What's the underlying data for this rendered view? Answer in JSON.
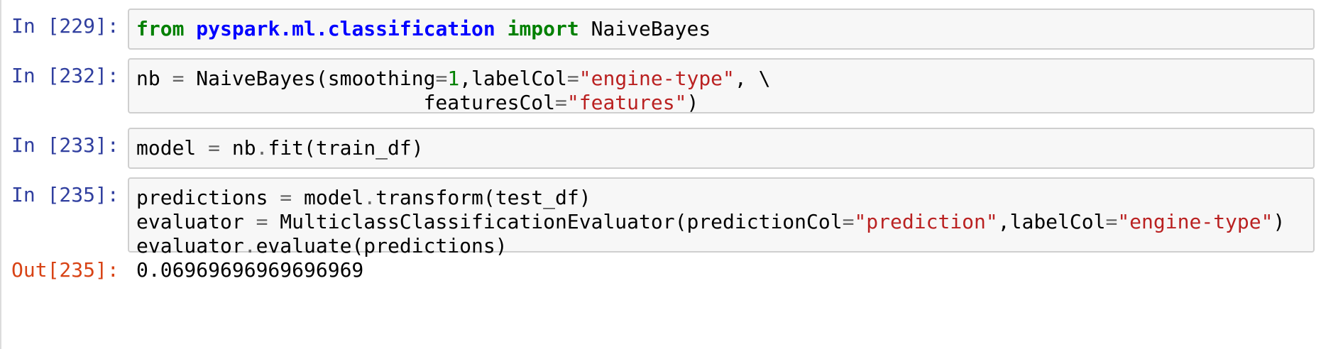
{
  "cells": [
    {
      "prompt": "In [229]:",
      "code": {
        "c1": {
          "kw_from": "from",
          "module": "pyspark.ml.classification",
          "kw_import": "import",
          "name": " NaiveBayes"
        }
      }
    },
    {
      "prompt": "In [232]:",
      "code": {
        "l1": {
          "a": "nb ",
          "eq": "=",
          "b": " NaiveBayes(smoothing",
          "eq2": "=",
          "num": "1",
          "c": ",labelCol",
          "eq3": "=",
          "s1": "\"engine-type\"",
          "d": ", \\"
        },
        "l2": {
          "indent": "                        featuresCol",
          "eq": "=",
          "s1": "\"features\"",
          "close": ")"
        }
      }
    },
    {
      "prompt": "In [233]:",
      "code": {
        "l1": {
          "a": "model ",
          "eq": "=",
          "b": " nb",
          "dot": ".",
          "c": "fit(train_df)"
        }
      }
    },
    {
      "prompt": "In [235]:",
      "code": {
        "l1": {
          "a": "predictions ",
          "eq": "=",
          "b": " model",
          "dot": ".",
          "c": "transform(test_df)"
        },
        "l2": {
          "a": "evaluator ",
          "eq": "=",
          "b": " MulticlassClassificationEvaluator(predictionCol",
          "eq2": "=",
          "s1": "\"prediction\"",
          "c": ",labelCol",
          "eq3": "=",
          "s2": "\"engine-type\"",
          "close": ")"
        },
        "l3": {
          "a": "evaluator",
          "dot": ".",
          "b": "evaluate(predictions)"
        }
      }
    }
  ],
  "output": {
    "prompt": "Out[235]:",
    "value": "0.06969696969696969"
  }
}
